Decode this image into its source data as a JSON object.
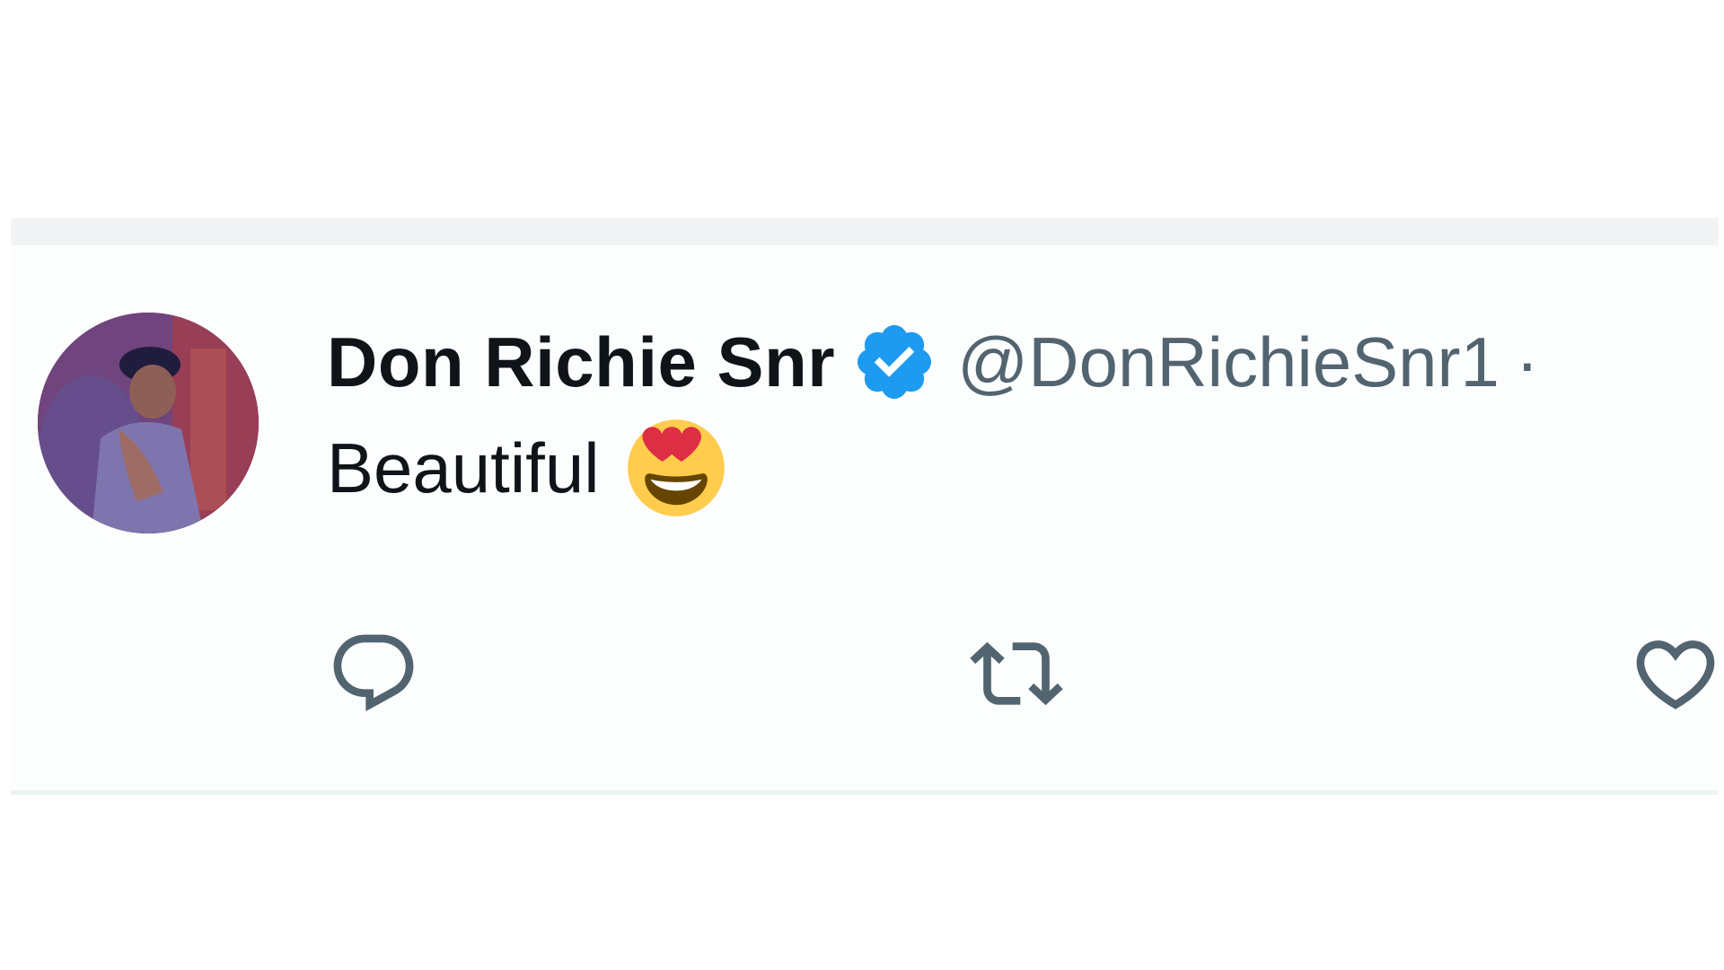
{
  "tweet": {
    "author": {
      "display_name": "Don Richie Snr",
      "handle": "@DonRichieSnr1",
      "separator": "·",
      "verified": true,
      "avatar_icon": "user-photo"
    },
    "text": "Beautiful",
    "emoji": "smiling-face-with-heart-eyes",
    "actions": [
      {
        "name": "reply",
        "icon": "speech-bubble-icon"
      },
      {
        "name": "retweet",
        "icon": "retweet-arrows-icon"
      },
      {
        "name": "like",
        "icon": "heart-icon"
      }
    ]
  },
  "colors": {
    "text_primary": "#0f1419",
    "text_secondary": "#536471",
    "verified_blue": "#1d9bf0",
    "background": "#ffffff"
  }
}
